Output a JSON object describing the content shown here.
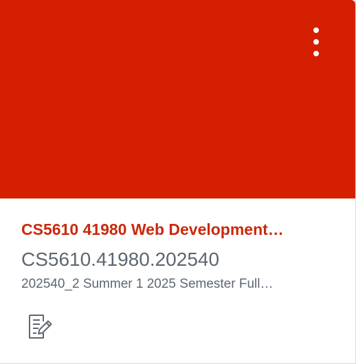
{
  "card": {
    "hero_color": "#d41f00",
    "title": "CS5610 41980 Web Development…",
    "course_code": "CS5610.41980.202540",
    "term": "202540_2 Summer 1 2025 Semester Full…",
    "options_icon": "kebab-vertical-icon",
    "action_icon": "assignments-icon"
  }
}
